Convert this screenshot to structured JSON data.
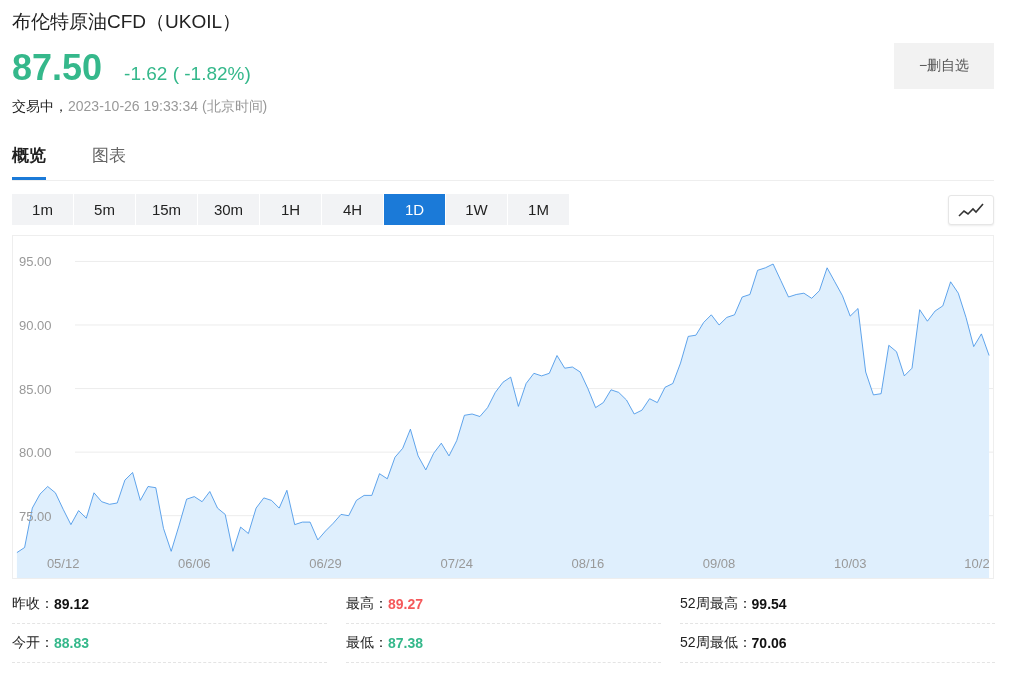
{
  "header": {
    "title": "布伦特原油CFD（UKOIL）",
    "price": "87.50",
    "change": "-1.62 ( -1.82%)",
    "status": "交易中，",
    "timestamp": "2023-10-26 19:33:34 (北京时间)",
    "watch_button": "−删自选"
  },
  "tabs": [
    {
      "label": "概览",
      "selected": true
    },
    {
      "label": "图表",
      "selected": false
    }
  ],
  "intervals": [
    {
      "label": "1m",
      "selected": false
    },
    {
      "label": "5m",
      "selected": false
    },
    {
      "label": "15m",
      "selected": false
    },
    {
      "label": "30m",
      "selected": false
    },
    {
      "label": "1H",
      "selected": false
    },
    {
      "label": "4H",
      "selected": false
    },
    {
      "label": "1D",
      "selected": true
    },
    {
      "label": "1W",
      "selected": false
    },
    {
      "label": "1M",
      "selected": false
    }
  ],
  "chart": {
    "chart_data": {
      "type": "area",
      "grid": true,
      "categories": [
        null,
        null,
        null,
        null,
        null,
        null,
        "05/12",
        null,
        null,
        null,
        null,
        null,
        null,
        null,
        null,
        null,
        null,
        null,
        null,
        null,
        null,
        null,
        null,
        "06/06",
        null,
        null,
        null,
        null,
        null,
        null,
        null,
        null,
        null,
        null,
        null,
        null,
        null,
        null,
        null,
        null,
        "06/29",
        null,
        null,
        null,
        null,
        null,
        null,
        null,
        null,
        null,
        null,
        null,
        null,
        null,
        null,
        null,
        null,
        "07/24",
        null,
        null,
        null,
        null,
        null,
        null,
        null,
        null,
        null,
        null,
        null,
        null,
        null,
        null,
        null,
        null,
        "08/16",
        null,
        null,
        null,
        null,
        null,
        null,
        null,
        null,
        null,
        null,
        null,
        null,
        null,
        null,
        null,
        null,
        "09/08",
        null,
        null,
        null,
        null,
        null,
        null,
        null,
        null,
        null,
        null,
        null,
        null,
        null,
        null,
        null,
        null,
        "10/03",
        null,
        null,
        null,
        null,
        null,
        null,
        null,
        null,
        null,
        null,
        null,
        null,
        null,
        null,
        null,
        null,
        "10/2",
        null
      ],
      "ylim": [
        70.1,
        97.0
      ],
      "yticks": [
        {
          "value": 75,
          "label": "75.00"
        },
        {
          "value": 80,
          "label": "80.00"
        },
        {
          "value": 85,
          "label": "85.00"
        },
        {
          "value": 90,
          "label": "90.00"
        },
        {
          "value": 95,
          "label": "95.00"
        }
      ],
      "series": [
        {
          "values": [
            72.1,
            72.5,
            75.6,
            76.7,
            77.3,
            76.8,
            75.5,
            74.3,
            75.4,
            74.8,
            76.8,
            76.1,
            75.9,
            76.0,
            77.8,
            78.4,
            76.2,
            77.3,
            77.2,
            74.0,
            72.2,
            74.2,
            76.3,
            76.5,
            76.1,
            76.9,
            75.6,
            75.1,
            72.2,
            74.1,
            73.6,
            75.6,
            76.4,
            76.2,
            75.6,
            77.0,
            74.3,
            74.5,
            74.5,
            73.1,
            73.8,
            74.4,
            75.1,
            75.0,
            76.2,
            76.6,
            76.6,
            78.3,
            77.9,
            79.6,
            80.3,
            81.8,
            79.7,
            78.6,
            79.9,
            80.7,
            79.7,
            80.9,
            82.9,
            83.0,
            82.8,
            83.5,
            84.7,
            85.5,
            85.9,
            83.6,
            85.4,
            86.2,
            86.0,
            86.2,
            87.6,
            86.6,
            86.7,
            86.3,
            85.0,
            83.5,
            83.9,
            84.9,
            84.7,
            84.1,
            83.0,
            83.3,
            84.2,
            83.9,
            85.1,
            85.4,
            87.0,
            89.1,
            89.2,
            90.2,
            90.8,
            90.0,
            90.6,
            90.8,
            92.2,
            92.4,
            94.3,
            94.5,
            94.8,
            93.5,
            92.2,
            92.4,
            92.5,
            92.1,
            92.7,
            94.5,
            93.4,
            92.3,
            90.7,
            91.3,
            86.3,
            84.5,
            84.6,
            88.4,
            87.9,
            86.0,
            86.6,
            91.2,
            90.3,
            91.1,
            91.5,
            93.4,
            92.5,
            90.6,
            88.3,
            89.3,
            87.6
          ]
        }
      ]
    }
  },
  "stats": [
    {
      "label": "昨收：",
      "value": "89.12",
      "color": "#111111"
    },
    {
      "label": "最高：",
      "value": "89.27",
      "color": "#f5595b"
    },
    {
      "label": "52周最高：",
      "value": "99.54",
      "color": "#111111"
    },
    {
      "label": "今开：",
      "value": "88.83",
      "color": "#35b88b"
    },
    {
      "label": "最低：",
      "value": "87.38",
      "color": "#35b88b"
    },
    {
      "label": "52周最低：",
      "value": "70.06",
      "color": "#111111"
    }
  ]
}
